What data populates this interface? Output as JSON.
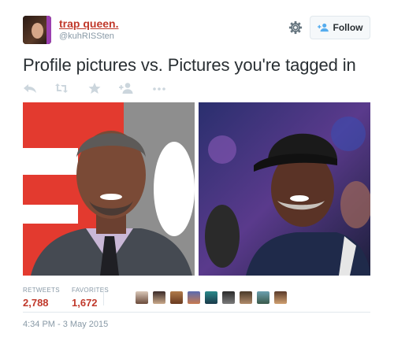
{
  "user": {
    "name": "trap queen.",
    "handle": "@kuhRISSten"
  },
  "follow_label": "Follow",
  "tweet_text": "Profile pictures vs. Pictures you're tagged in",
  "stats": {
    "retweets_label": "RETWEETS",
    "retweets": "2,788",
    "favorites_label": "FAVORITES",
    "favorites": "1,672"
  },
  "timestamp": "4:34 PM - 3 May 2015",
  "icons": [
    "gear-icon",
    "add-user-icon",
    "reply-icon",
    "retweet-icon",
    "favorite-icon",
    "follow-user-icon",
    "more-icon"
  ],
  "colors": {
    "name": "#c0392b",
    "stat_number": "#c0392b",
    "secondary_text": "#8899a6",
    "icon_muted": "#ccd6dd",
    "follow_bg": "#f5f8fa"
  }
}
